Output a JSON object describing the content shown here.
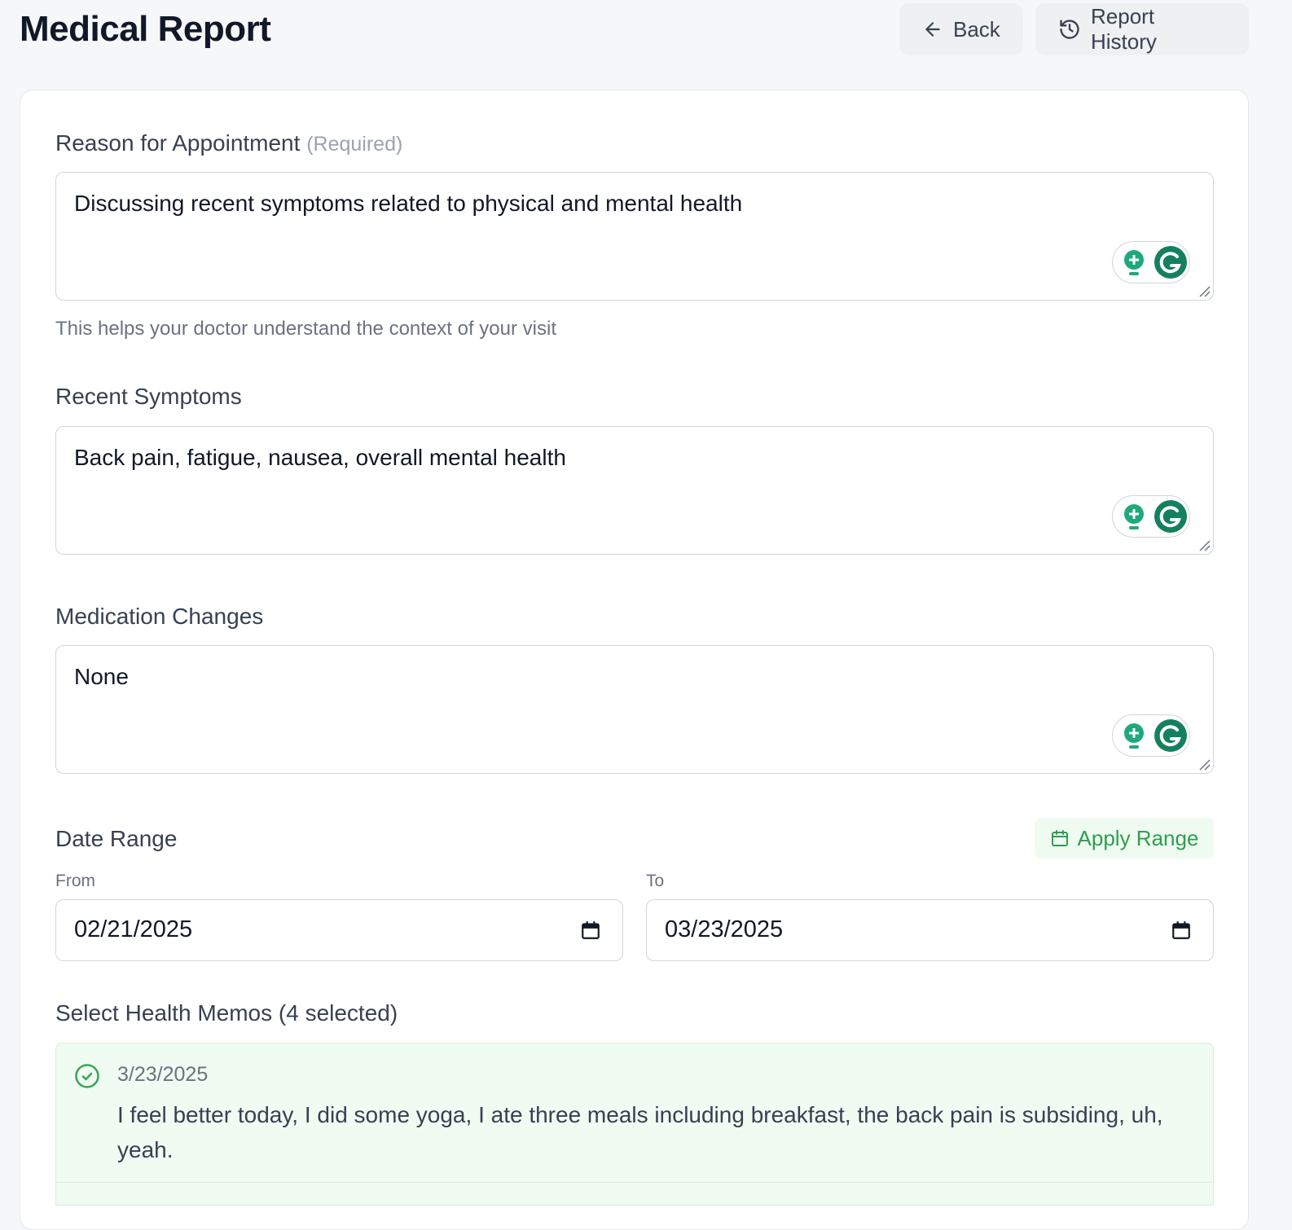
{
  "header": {
    "title": "Medical Report",
    "back_label": "Back",
    "history_label": "Report History"
  },
  "form": {
    "reason": {
      "label": "Reason for Appointment",
      "required_tag": "(Required)",
      "value": "Discussing recent symptoms related to physical and mental health",
      "hint": "This helps your doctor understand the context of your visit"
    },
    "symptoms": {
      "label": "Recent Symptoms",
      "value": "Back pain, fatigue, nausea, overall mental health"
    },
    "medication": {
      "label": "Medication Changes",
      "value": "None"
    },
    "date_range": {
      "label": "Date Range",
      "apply_label": "Apply Range",
      "from_label": "From",
      "from_value": "02/21/2025",
      "to_label": "To",
      "to_value": "03/23/2025"
    },
    "memos": {
      "label": "Select Health Memos (4 selected)",
      "items": [
        {
          "date": "3/23/2025",
          "text": "I feel better today, I did some yoga, I ate three meals including breakfast, the back pain is subsiding, uh, yeah.",
          "selected": true
        }
      ]
    }
  },
  "colors": {
    "accent_green": "#2f9e4f",
    "grammarly_green": "#15805e",
    "memo_bg": "#f0fbf2"
  },
  "icons": [
    "arrow-left-icon",
    "history-icon",
    "lightbulb-icon",
    "grammarly-icon",
    "calendar-icon",
    "check-circle-icon"
  ]
}
